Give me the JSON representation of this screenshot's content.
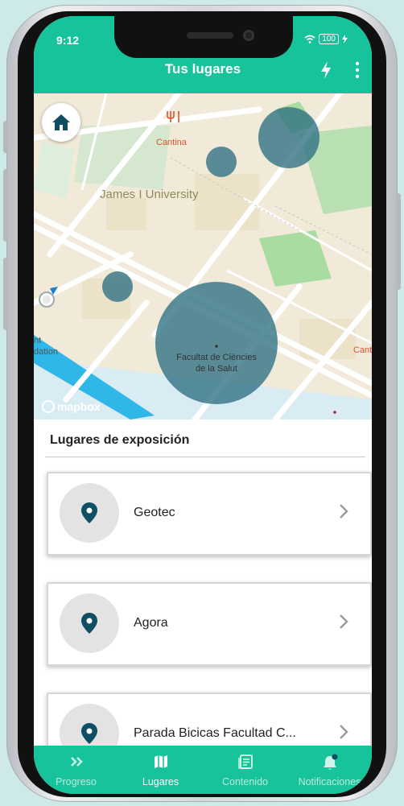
{
  "status_bar": {
    "time": "9:12",
    "battery": "100"
  },
  "header": {
    "title": "Tus lugares"
  },
  "map": {
    "labels": {
      "cantina_top": "Cantina",
      "university": "James I University",
      "cantina_right": "Cantina",
      "faculty_line1": "Facultat de Ciències",
      "faculty_line2": "de la Salut",
      "left_partial_1": "nt",
      "left_partial_2": "dation",
      "attribution": "mapbox"
    }
  },
  "section": {
    "title": "Lugares de exposición"
  },
  "places": [
    {
      "name": "Geotec"
    },
    {
      "name": "Agora"
    },
    {
      "name": "Parada Bicicas Facultad C..."
    }
  ],
  "nav": {
    "items": [
      {
        "label": "Progreso"
      },
      {
        "label": "Lugares"
      },
      {
        "label": "Contenido"
      },
      {
        "label": "Notificaciones"
      }
    ]
  },
  "colors": {
    "brand": "#16c39a",
    "marker": "#0f4e63",
    "circle": "#2e6f83"
  }
}
